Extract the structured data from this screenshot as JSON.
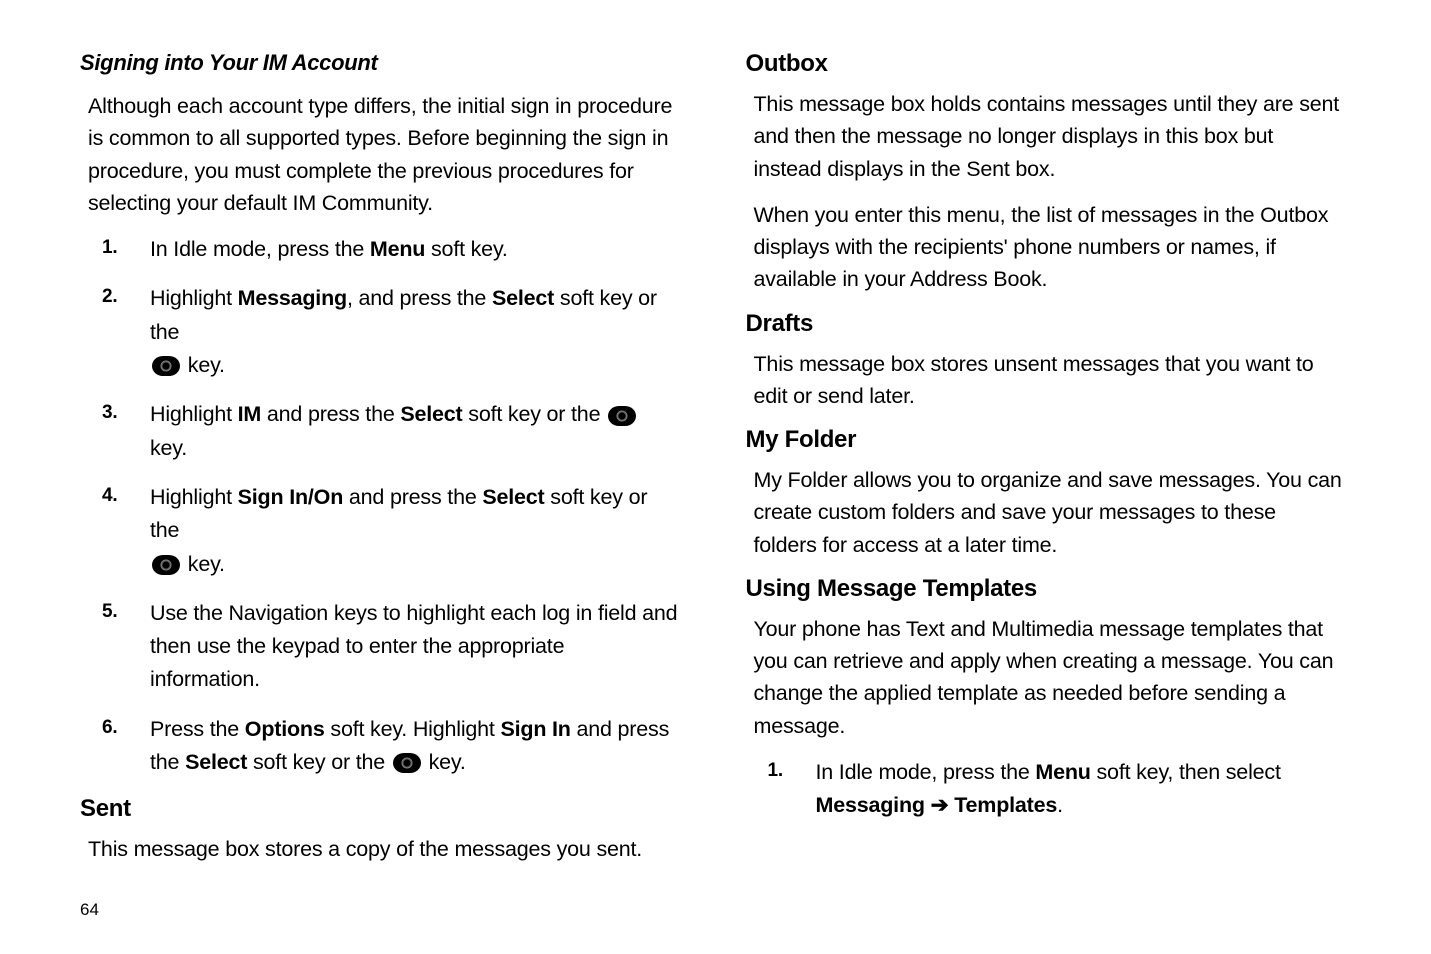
{
  "left": {
    "h1": "Signing into Your IM Account",
    "p1": "Although each account type differs, the initial sign in procedure is common to all supported types. Before beginning the sign in procedure, you must complete the previous procedures for selecting your default IM Community.",
    "s1a": "In Idle mode, press the ",
    "s1b": "Menu",
    "s1c": " soft key.",
    "s2a": "Highlight ",
    "s2b": "Messaging",
    "s2c": ", and press the ",
    "s2d": "Select",
    "s2e": " soft key or the ",
    "s2f": " key.",
    "s3a": "Highlight ",
    "s3b": "IM",
    "s3c": " and press the ",
    "s3d": "Select",
    "s3e": " soft key or the ",
    "s3f": " key.",
    "s4a": "Highlight ",
    "s4b": "Sign In/On",
    "s4c": " and press the ",
    "s4d": "Select",
    "s4e": " soft key or the ",
    "s4f": " key.",
    "s5": "Use the Navigation keys to highlight each log in field and then use the keypad to enter the appropriate information.",
    "s6a": "Press the ",
    "s6b": "Options",
    "s6c": " soft key. Highlight ",
    "s6d": "Sign In",
    "s6e": " and press the ",
    "s6f": "Select",
    "s6g": " soft key or the ",
    "s6h": " key.",
    "h2": "Sent",
    "p2": "This message box stores a copy of the messages you sent."
  },
  "right": {
    "h1": "Outbox",
    "p1": "This message box holds contains messages until they are sent and then the message no longer displays in this box but instead displays in the Sent box.",
    "p2": "When you enter this menu, the list of messages in the Outbox displays with the recipients' phone numbers or names, if available in your Address Book.",
    "h2": "Drafts",
    "p3": "This message box stores unsent messages that you want to edit or send later.",
    "h3": "My Folder",
    "p4": "My Folder allows you to organize and save messages. You can create custom folders and save your messages to these folders for access at a later time.",
    "h4": "Using Message Templates",
    "p5": "Your phone has Text and Multimedia message templates that you can retrieve and apply when creating a message. You can change the applied template as needed before sending a message.",
    "s1a": "In Idle mode, press the ",
    "s1b": "Menu",
    "s1c": " soft key, then select ",
    "s1d": "Messaging",
    "s1e": " ➔ ",
    "s1f": "Templates",
    "s1g": "."
  },
  "pageNum": "64"
}
